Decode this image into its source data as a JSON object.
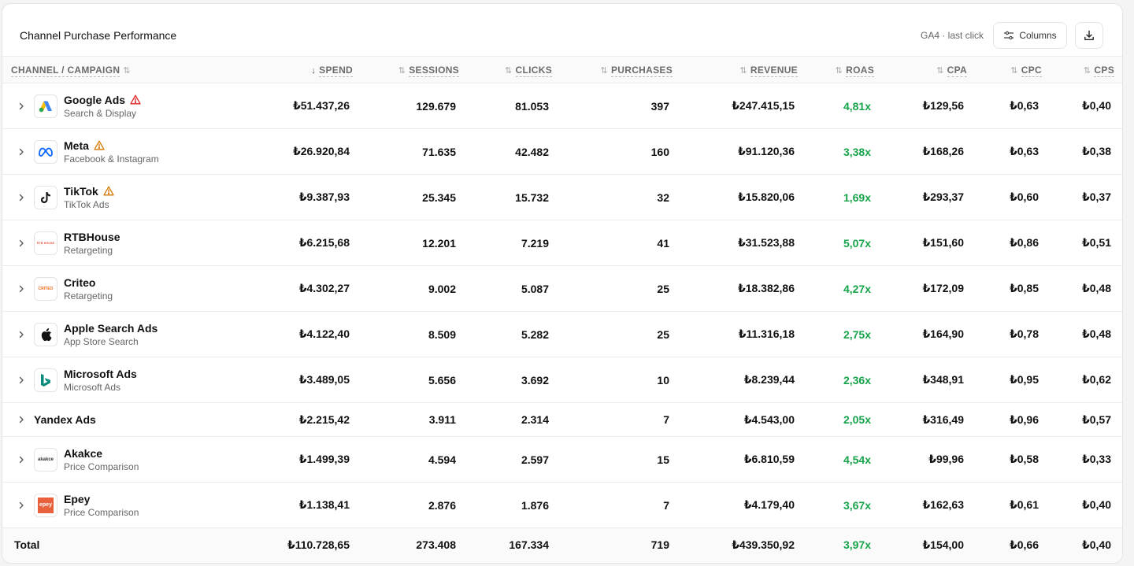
{
  "header": {
    "title": "Channel Purchase Performance",
    "source": "GA4 · last click",
    "columns_label": "Columns"
  },
  "columns": [
    {
      "key": "channel",
      "label": "CHANNEL / CAMPAIGN"
    },
    {
      "key": "spend",
      "label": "SPEND",
      "sort": "↓"
    },
    {
      "key": "sessions",
      "label": "SESSIONS",
      "sort": "⇅"
    },
    {
      "key": "clicks",
      "label": "CLICKS",
      "sort": "⇅"
    },
    {
      "key": "purchases",
      "label": "PURCHASES",
      "sort": "⇅"
    },
    {
      "key": "revenue",
      "label": "REVENUE",
      "sort": "⇅"
    },
    {
      "key": "roas",
      "label": "ROAS",
      "sort": "⇅"
    },
    {
      "key": "cpa",
      "label": "CPA",
      "sort": "⇅"
    },
    {
      "key": "cpc",
      "label": "CPC",
      "sort": "⇅"
    },
    {
      "key": "cps",
      "label": "CPS",
      "sort": "⇅"
    }
  ],
  "rows": [
    {
      "name": "Google Ads",
      "sub": "Search & Display",
      "logo": "google-ads-logo",
      "warn": "red",
      "spend": "₺51.437,26",
      "sessions": "129.679",
      "clicks": "81.053",
      "purchases": "397",
      "revenue": "₺247.415,15",
      "roas": "4,81x",
      "cpa": "₺129,56",
      "cpc": "₺0,63",
      "cps": "₺0,40"
    },
    {
      "name": "Meta",
      "sub": "Facebook & Instagram",
      "logo": "meta-logo",
      "warn": "amber",
      "spend": "₺26.920,84",
      "sessions": "71.635",
      "clicks": "42.482",
      "purchases": "160",
      "revenue": "₺91.120,36",
      "roas": "3,38x",
      "cpa": "₺168,26",
      "cpc": "₺0,63",
      "cps": "₺0,38"
    },
    {
      "name": "TikTok",
      "sub": "TikTok Ads",
      "logo": "tiktok-logo",
      "warn": "amber",
      "spend": "₺9.387,93",
      "sessions": "25.345",
      "clicks": "15.732",
      "purchases": "32",
      "revenue": "₺15.820,06",
      "roas": "1,69x",
      "cpa": "₺293,37",
      "cpc": "₺0,60",
      "cps": "₺0,37"
    },
    {
      "name": "RTBHouse",
      "sub": "Retargeting",
      "logo": "rtbhouse-logo",
      "warn": "",
      "spend": "₺6.215,68",
      "sessions": "12.201",
      "clicks": "7.219",
      "purchases": "41",
      "revenue": "₺31.523,88",
      "roas": "5,07x",
      "cpa": "₺151,60",
      "cpc": "₺0,86",
      "cps": "₺0,51"
    },
    {
      "name": "Criteo",
      "sub": "Retargeting",
      "logo": "criteo-logo",
      "warn": "",
      "spend": "₺4.302,27",
      "sessions": "9.002",
      "clicks": "5.087",
      "purchases": "25",
      "revenue": "₺18.382,86",
      "roas": "4,27x",
      "cpa": "₺172,09",
      "cpc": "₺0,85",
      "cps": "₺0,48"
    },
    {
      "name": "Apple Search Ads",
      "sub": "App Store Search",
      "logo": "apple-logo",
      "warn": "",
      "spend": "₺4.122,40",
      "sessions": "8.509",
      "clicks": "5.282",
      "purchases": "25",
      "revenue": "₺11.316,18",
      "roas": "2,75x",
      "cpa": "₺164,90",
      "cpc": "₺0,78",
      "cps": "₺0,48"
    },
    {
      "name": "Microsoft Ads",
      "sub": "Microsoft Ads",
      "logo": "bing-logo",
      "warn": "",
      "spend": "₺3.489,05",
      "sessions": "5.656",
      "clicks": "3.692",
      "purchases": "10",
      "revenue": "₺8.239,44",
      "roas": "2,36x",
      "cpa": "₺348,91",
      "cpc": "₺0,95",
      "cps": "₺0,62"
    },
    {
      "name": "Yandex Ads",
      "sub": "",
      "logo": "",
      "warn": "",
      "spend": "₺2.215,42",
      "sessions": "3.911",
      "clicks": "2.314",
      "purchases": "7",
      "revenue": "₺4.543,00",
      "roas": "2,05x",
      "cpa": "₺316,49",
      "cpc": "₺0,96",
      "cps": "₺0,57"
    },
    {
      "name": "Akakce",
      "sub": "Price Comparison",
      "logo": "akakce-logo",
      "warn": "",
      "spend": "₺1.499,39",
      "sessions": "4.594",
      "clicks": "2.597",
      "purchases": "15",
      "revenue": "₺6.810,59",
      "roas": "4,54x",
      "cpa": "₺99,96",
      "cpc": "₺0,58",
      "cps": "₺0,33"
    },
    {
      "name": "Epey",
      "sub": "Price Comparison",
      "logo": "epey-logo",
      "warn": "",
      "spend": "₺1.138,41",
      "sessions": "2.876",
      "clicks": "1.876",
      "purchases": "7",
      "revenue": "₺4.179,40",
      "roas": "3,67x",
      "cpa": "₺162,63",
      "cpc": "₺0,61",
      "cps": "₺0,40"
    }
  ],
  "total": {
    "label": "Total",
    "spend": "₺110.728,65",
    "sessions": "273.408",
    "clicks": "167.334",
    "purchases": "719",
    "revenue": "₺439.350,92",
    "roas": "3,97x",
    "cpa": "₺154,00",
    "cpc": "₺0,66",
    "cps": "₺0,40"
  },
  "colors": {
    "roas": "#16a34a",
    "warn_red": "#dc2626",
    "warn_amber": "#d97706"
  },
  "logo_text": {
    "rtbhouse": "RTB HOUSE",
    "criteo": "CRITEO",
    "akakce": "akakce",
    "epey": "epey"
  }
}
